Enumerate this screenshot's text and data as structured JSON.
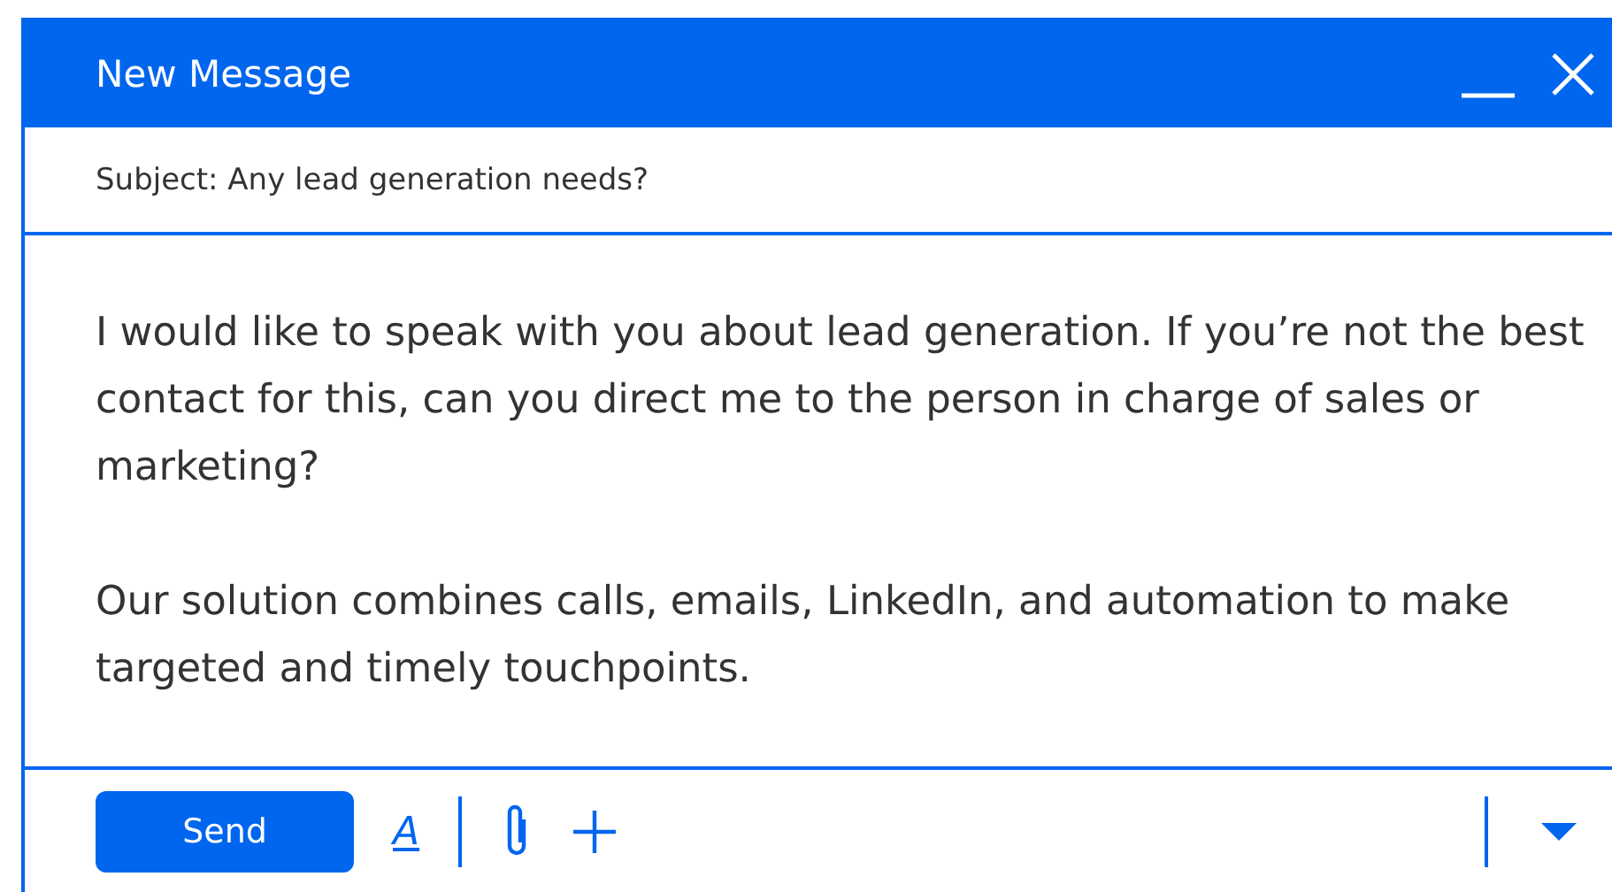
{
  "window": {
    "title": "New Message"
  },
  "subject": "Subject: Any lead generation needs?",
  "body": [
    "I would like to speak with you about lead generation. If you’re not the best contact for this, can you direct me to the person in charge of sales or marketing?",
    "Our solution combines calls, emails, LinkedIn, and automation to make targeted and timely touchpoints."
  ],
  "toolbar": {
    "send": "Send",
    "format": "A"
  }
}
